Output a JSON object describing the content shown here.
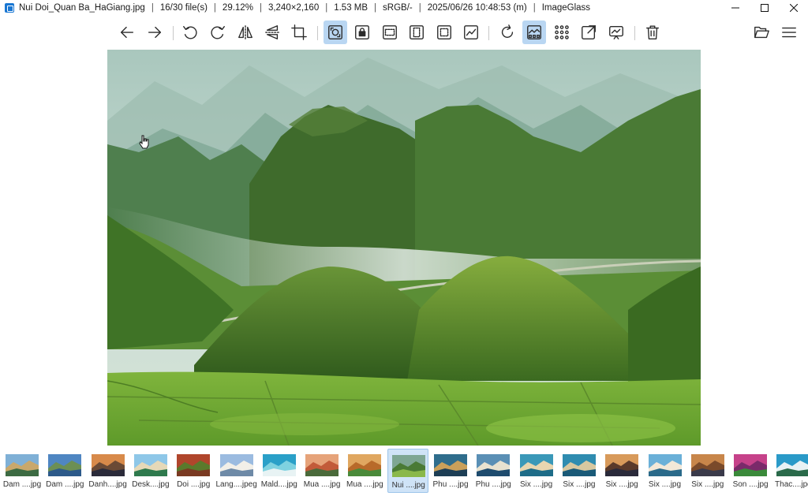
{
  "titlebar": {
    "filename": "Nui Doi_Quan Ba_HaGiang.jpg",
    "file_index": "16/30 file(s)",
    "zoom": "29.12%",
    "dimensions": "3,240×2,160",
    "filesize": "1.53 MB",
    "colorspace": "sRGB/-",
    "modified": "2025/06/26 10:48:53 (m)",
    "app_name": "ImageGlass",
    "separator": "|"
  },
  "window_controls": [
    "minimize-icon",
    "maximize-icon",
    "close-icon"
  ],
  "toolbar": {
    "icons": [
      "arrow-left-icon",
      "arrow-right-icon",
      "rotate-left-icon",
      "rotate-right-icon",
      "flip-horizontal-icon",
      "flip-vertical-icon",
      "crop-icon",
      "auto-zoom-icon",
      "lock-zoom-icon",
      "scale-to-width-icon",
      "scale-to-height-icon",
      "scale-to-fit-icon",
      "scale-to-fill-icon",
      "refresh-icon",
      "thumbnail-bar-icon",
      "gallery-icon",
      "fullscreen-icon",
      "slideshow-icon",
      "delete-icon",
      "open-folder-icon",
      "menu-icon"
    ],
    "active_buttons": [
      "auto-zoom-icon",
      "thumbnail-bar-icon"
    ],
    "active_color": "#b9d6f2"
  },
  "thumbnails": [
    {
      "label": "Dam ....jpg"
    },
    {
      "label": "Dam ....jpg"
    },
    {
      "label": "Danh....jpg"
    },
    {
      "label": "Desk....jpg"
    },
    {
      "label": "Doi ....jpg"
    },
    {
      "label": "Lang....jpeg"
    },
    {
      "label": "Mald....jpg"
    },
    {
      "label": "Mua ....jpg"
    },
    {
      "label": "Mua ....jpg"
    },
    {
      "label": "Nui ....jpg",
      "active": true
    },
    {
      "label": "Phu ....jpg"
    },
    {
      "label": "Phu ....jpg"
    },
    {
      "label": "Six ....jpg"
    },
    {
      "label": "Six ....jpg"
    },
    {
      "label": "Six ....jpg"
    },
    {
      "label": "Six ....jpg"
    },
    {
      "label": "Six ....jpg"
    },
    {
      "label": "Son ....jpg"
    },
    {
      "label": "Thac....jpg"
    }
  ],
  "colors": {
    "accent": "#b9d6f2",
    "thumb_active_bg": "#cfe3f7"
  }
}
